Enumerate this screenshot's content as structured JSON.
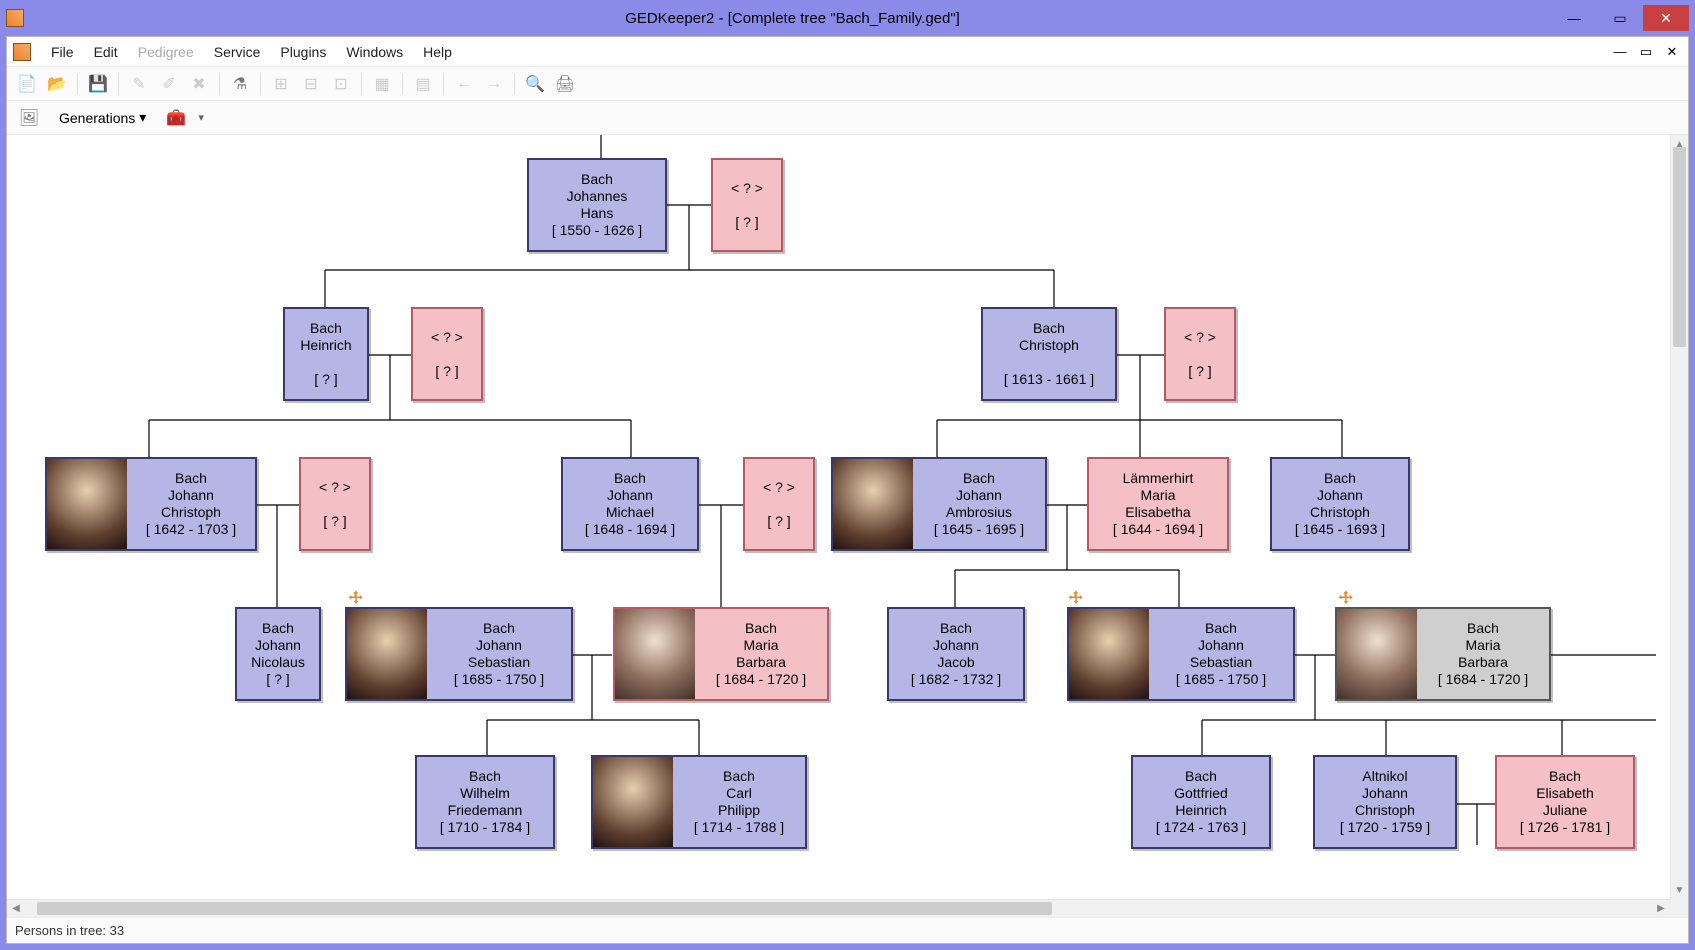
{
  "titlebar": {
    "title": "GEDKeeper2 - [Complete tree \"Bach_Family.ged\"]"
  },
  "menu": {
    "file": "File",
    "edit": "Edit",
    "pedigree": "Pedigree",
    "service": "Service",
    "plugins": "Plugins",
    "windows": "Windows",
    "help": "Help"
  },
  "toolbar2": {
    "generations": "Generations"
  },
  "status": {
    "persons": "Persons in tree: 33"
  },
  "cards": {
    "johannes": {
      "l1": "Bach",
      "l2": "Johannes",
      "l3": "Hans",
      "l4": "[ 1550 - 1626 ]"
    },
    "unk_w1": {
      "l1": "< ? >",
      "l2": "[ ? ]"
    },
    "heinrich": {
      "l1": "Bach",
      "l2": "Heinrich",
      "l3": "[ ? ]"
    },
    "unk_w_hein": {
      "l1": "< ? >",
      "l2": "[ ? ]"
    },
    "christoph": {
      "l1": "Bach",
      "l2": "Christoph",
      "l3": "[ 1613 - 1661 ]"
    },
    "unk_w_chr": {
      "l1": "< ? >",
      "l2": "[ ? ]"
    },
    "jc1642": {
      "l1": "Bach",
      "l2": "Johann",
      "l3": "Christoph",
      "l4": "[ 1642 - 1703 ]"
    },
    "unk_w_jc": {
      "l1": "< ? >",
      "l2": "[ ? ]"
    },
    "jmichael": {
      "l1": "Bach",
      "l2": "Johann",
      "l3": "Michael",
      "l4": "[ 1648 - 1694 ]"
    },
    "unk_w_jm": {
      "l1": "< ? >",
      "l2": "[ ? ]"
    },
    "jambrosius": {
      "l1": "Bach",
      "l2": "Johann",
      "l3": "Ambrosius",
      "l4": "[ 1645 - 1695 ]"
    },
    "lammerhirt": {
      "l1": "Lämmerhirt",
      "l2": "Maria",
      "l3": "Elisabetha",
      "l4": "[ 1644 - 1694 ]"
    },
    "jc1645": {
      "l1": "Bach",
      "l2": "Johann",
      "l3": "Christoph",
      "l4": "[ 1645 - 1693 ]"
    },
    "jnicolaus": {
      "l1": "Bach",
      "l2": "Johann",
      "l3": "Nicolaus",
      "l4": "[ ? ]"
    },
    "jsb1": {
      "l1": "Bach",
      "l2": "Johann",
      "l3": "Sebastian",
      "l4": "[ 1685 - 1750 ]"
    },
    "mariab1": {
      "l1": "Bach",
      "l2": "Maria",
      "l3": "Barbara",
      "l4": "[ 1684 - 1720 ]"
    },
    "jjacob": {
      "l1": "Bach",
      "l2": "Johann",
      "l3": "Jacob",
      "l4": "[ 1682 - 1732 ]"
    },
    "jsb2": {
      "l1": "Bach",
      "l2": "Johann",
      "l3": "Sebastian",
      "l4": "[ 1685 - 1750 ]"
    },
    "mariab2": {
      "l1": "Bach",
      "l2": "Maria",
      "l3": "Barbara",
      "l4": "[ 1684 - 1720 ]"
    },
    "wfried": {
      "l1": "Bach",
      "l2": "Wilhelm",
      "l3": "Friedemann",
      "l4": "[ 1710 - 1784 ]"
    },
    "cpe": {
      "l1": "Bach",
      "l2": "Carl",
      "l3": "Philipp",
      "l4": "[ 1714 - 1788 ]"
    },
    "gottfried": {
      "l1": "Bach",
      "l2": "Gottfried",
      "l3": "Heinrich",
      "l4": "[ 1724 - 1763 ]"
    },
    "altnikol": {
      "l1": "Altnikol",
      "l2": "Johann",
      "l3": "Christoph",
      "l4": "[ 1720 - 1759 ]"
    },
    "ejuliane": {
      "l1": "Bach",
      "l2": "Elisabeth",
      "l3": "Juliane",
      "l4": "[ 1726 - 1781 ]"
    }
  }
}
